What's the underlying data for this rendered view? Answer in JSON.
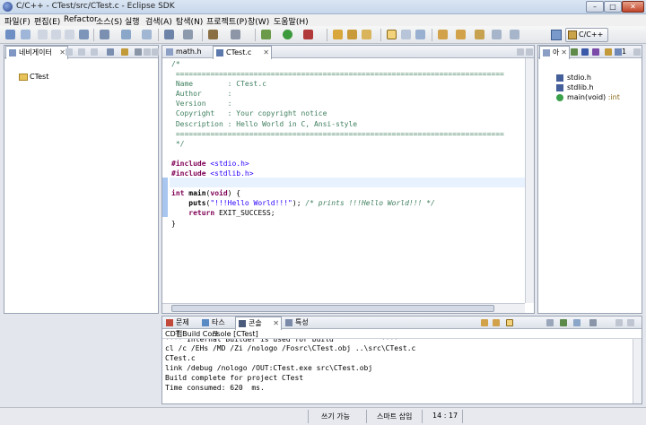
{
  "window": {
    "title": "C/C++ - CTest/src/CTest.c - Eclipse SDK",
    "minimize": "–",
    "maximize": "□",
    "close": "✕"
  },
  "menu": [
    "파일(F)",
    "편집(E)",
    "Refactor",
    "소스(S)",
    "실행",
    "검색(A)",
    "탐색(N)",
    "프로젝트(P)",
    "창(W)",
    "도움말(H)"
  ],
  "toolbar": {
    "perspective_label": "C/C++"
  },
  "navigator": {
    "tab_label": "네비게이터",
    "close": "✕",
    "items": [
      {
        "label": "CTest",
        "icon": "folder-icon"
      }
    ]
  },
  "editor": {
    "tabs": [
      {
        "label": "math.h",
        "active": false
      },
      {
        "label": "CTest.c",
        "active": true,
        "close": "✕"
      }
    ]
  },
  "outline": {
    "tab_label": "아",
    "tab2_label": "1",
    "items": [
      {
        "label": "stdio.h",
        "icon": "include-icon"
      },
      {
        "label": "stdlib.h",
        "icon": "include-icon"
      },
      {
        "label": "main(void)",
        "suffix": " :int",
        "icon": "function-icon"
      }
    ]
  },
  "bottom": {
    "tabs": [
      "문제점",
      "타스크",
      "콘솔",
      "특성"
    ],
    "active_tab": "콘솔",
    "close": "✕",
    "console_title": "CDT Build Console [CTest]",
    "console_lines": [
      "**** Internal Builder is used for build           ****",
      "cl /c /EHs /MD /Zi /nologo /Fosrc\\CTest.obj ..\\src\\CTest.c",
      "CTest.c",
      "link /debug /nologo /OUT:CTest.exe src\\CTest.obj",
      "Build complete for project CTest",
      "Time consumed: 620  ms."
    ]
  },
  "statusbar": {
    "writable": "쓰기 가능",
    "insert_mode": "스마트 삽입",
    "position": "14 : 17"
  }
}
